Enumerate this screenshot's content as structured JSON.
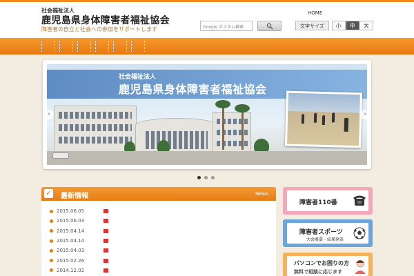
{
  "header": {
    "org_small": "社会福祉法人",
    "org_name": "鹿児島県身体障害者福祉協会",
    "tagline": "障害者の自立と社会への参加をサポートします",
    "search_placeholder": "Google カスタム検索",
    "toplinks": [
      "HOME",
      "",
      ""
    ],
    "fontsize_label": "文字サイズ",
    "fontsize_options": [
      "小",
      "中",
      "大"
    ],
    "fontsize_selected": "中"
  },
  "nav": {
    "items": [
      "",
      "",
      "",
      "",
      "",
      ""
    ]
  },
  "slider": {
    "subtitle": "社会福祉法人",
    "title": "鹿児島県身体障害者福祉協会",
    "prev": "‹",
    "next": "›",
    "dot_count": 3,
    "active_dot": 0
  },
  "news": {
    "title": "最新情報",
    "link": "News",
    "items": [
      {
        "date": "2015.06.05",
        "text": ""
      },
      {
        "date": "2015.06.03",
        "text": ""
      },
      {
        "date": "2015.04.14",
        "text": ""
      },
      {
        "date": "2015.04.14",
        "text": ""
      },
      {
        "date": "2015.04.03",
        "text": ""
      },
      {
        "date": "2015.02.26",
        "text": ""
      },
      {
        "date": "2014.12.02",
        "text": ""
      }
    ]
  },
  "sidebar": {
    "banners": [
      {
        "title": "障害者110番",
        "sub": "",
        "color": "#f3a7b8",
        "icon": "telephone-icon"
      },
      {
        "title": "障害者スポーツ",
        "sub": "大会概要・結果発表",
        "color": "#6aa6dc",
        "icon": "soccer-ball-icon"
      },
      {
        "title": "パソコンでお困りの方",
        "sub": "無料で相談に応じます",
        "color": "#f5b25a",
        "icon": "person-icon"
      }
    ]
  },
  "colors": {
    "accent": "#f08a1d",
    "nav": "#e8780f",
    "background": "#f3ece1"
  }
}
